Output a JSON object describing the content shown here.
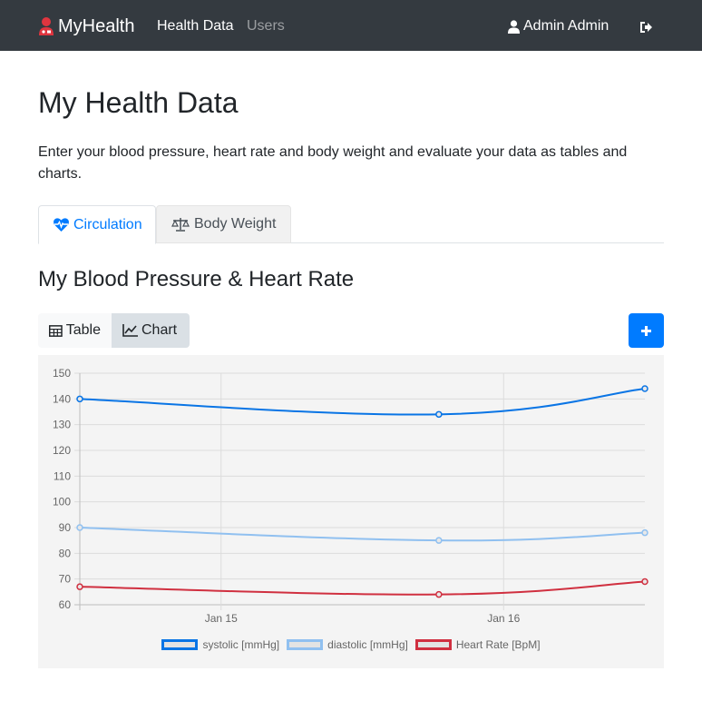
{
  "navbar": {
    "brand": "MyHealth",
    "links": [
      "Health Data",
      "Users"
    ],
    "user_name": "Admin Admin"
  },
  "page": {
    "title": "My Health Data",
    "description": "Enter your blood pressure, heart rate and body weight and evaluate your data as tables and charts."
  },
  "tabs": [
    {
      "label": "Circulation",
      "icon": "heartbeat-icon",
      "active": true
    },
    {
      "label": "Body Weight",
      "icon": "balance-scale-icon",
      "active": false
    }
  ],
  "section": {
    "title": "My Blood Pressure & Heart Rate"
  },
  "view_toggle": {
    "table_label": "Table",
    "chart_label": "Chart",
    "active": "Chart"
  },
  "add_button_icon": "plus-icon",
  "colors": {
    "navbar": "#343a40",
    "primary": "#007bff",
    "systolic": "#0a75e5",
    "diastolic": "#90c0f0",
    "heart_rate": "#d03040"
  },
  "chart_data": {
    "type": "line",
    "x": [
      "2024-01-14T12:00",
      "2024-01-15T18:30",
      "2024-01-16T12:00"
    ],
    "x_tick_labels": [
      "Jan 15",
      "Jan 16"
    ],
    "ylim": [
      60,
      150
    ],
    "y_ticks": [
      60,
      70,
      80,
      90,
      100,
      110,
      120,
      130,
      140,
      150
    ],
    "grid": true,
    "legend_position": "bottom",
    "series": [
      {
        "name": "systolic [mmHg]",
        "values": [
          140,
          134,
          144
        ],
        "color": "#0a75e5"
      },
      {
        "name": "diastolic [mmHg]",
        "values": [
          90,
          85,
          88
        ],
        "color": "#90c0f0"
      },
      {
        "name": "Heart Rate [BpM]",
        "values": [
          67,
          64,
          69
        ],
        "color": "#d03040"
      }
    ]
  }
}
